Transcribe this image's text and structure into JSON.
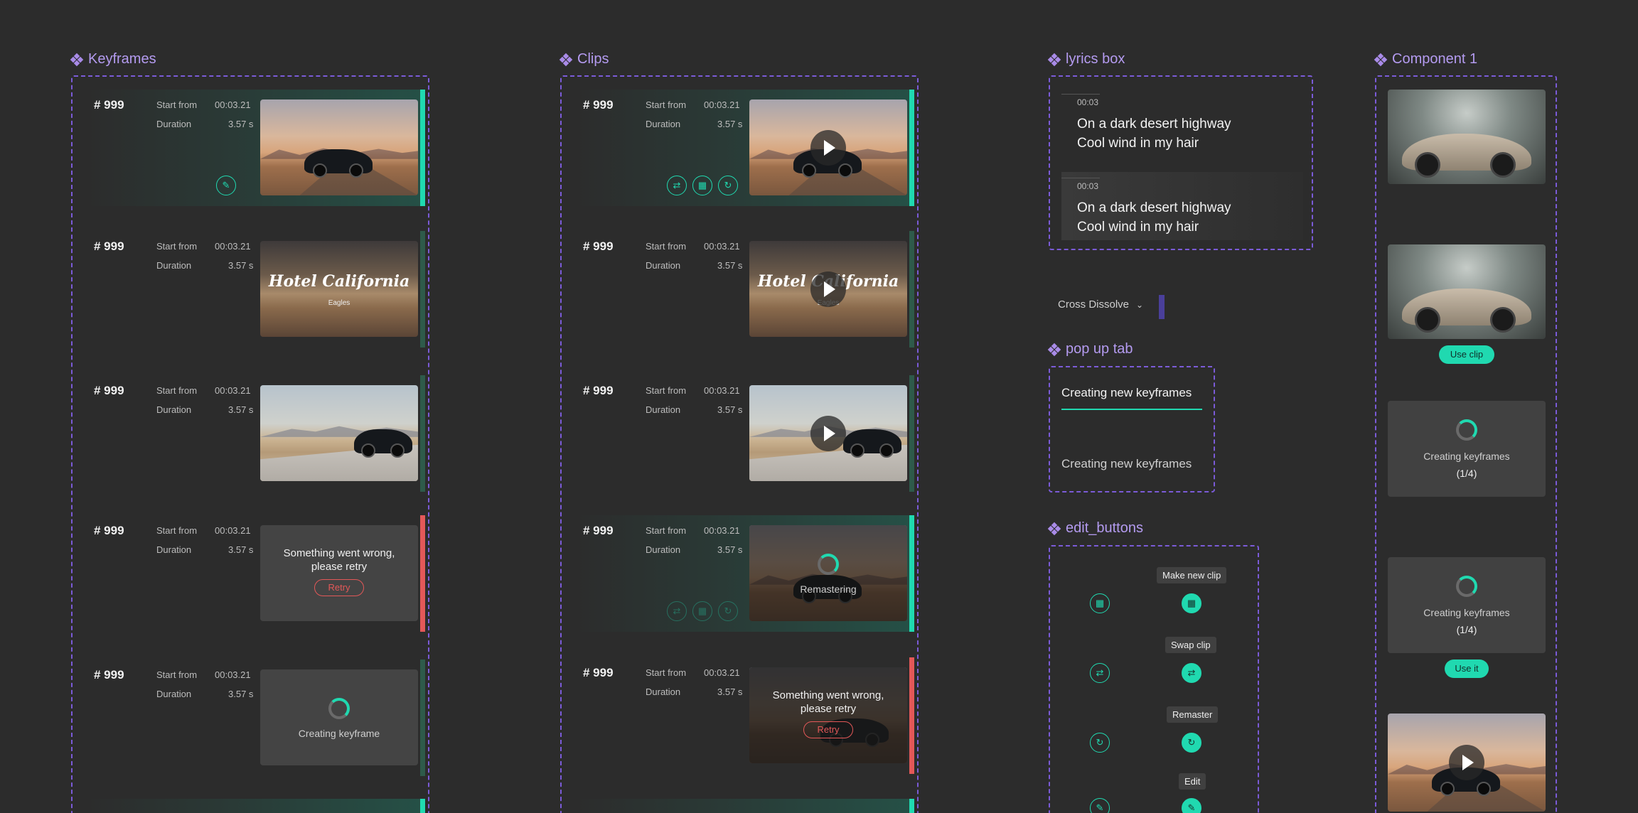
{
  "sections": {
    "keyframes": "Keyframes",
    "clips": "Clips",
    "lyrics": "lyrics box",
    "component": "Component 1",
    "popup": "pop up tab",
    "edit": "edit_buttons"
  },
  "row_common": {
    "index": "# 999",
    "start_label": "Start from",
    "start_value": "00:03.21",
    "duration_label": "Duration",
    "duration_value": "3.57 s"
  },
  "thumb_texts": {
    "hotel_title": "Hotel California",
    "hotel_subtitle": "Eagles",
    "error": "Something went wrong, please retry",
    "retry": "Retry",
    "creating_keyframe": "Creating keyframe",
    "remastering": "Remastering"
  },
  "lyrics": [
    {
      "time": "00:03",
      "line1": "On a dark desert highway",
      "line2": "Cool wind in my hair"
    },
    {
      "time": "00:03",
      "line1": "On a dark desert highway",
      "line2": "Cool wind in my hair"
    }
  ],
  "transition": {
    "selected": "Cross Dissolve"
  },
  "popup_tabs": [
    "Creating new keyframes",
    "Creating new keyframes"
  ],
  "edit_tooltips": [
    "Make new clip",
    "Swap clip",
    "Remaster",
    "Edit"
  ],
  "component": {
    "use_clip": "Use clip",
    "creating": "Creating keyframes",
    "progress": "(1/4)",
    "use_it": "Use it"
  },
  "colors": {
    "accent": "#20d9b0",
    "error": "#e35858",
    "frame": "#7b5bd8",
    "title": "#b49bf0"
  }
}
